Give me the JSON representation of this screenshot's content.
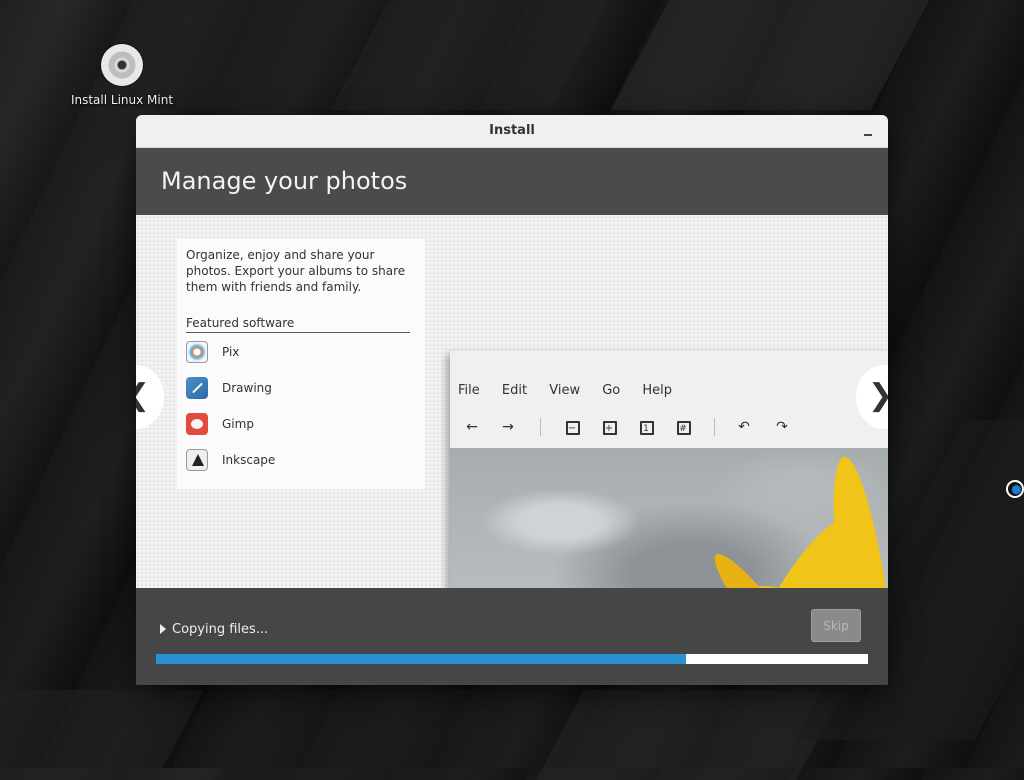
{
  "desktop": {
    "icon_label": "Install Linux Mint"
  },
  "window": {
    "title": "Install"
  },
  "header": {
    "heading": "Manage your photos"
  },
  "slide": {
    "description": "Organize, enjoy and share your photos. Export your albums to share them with friends and family.",
    "featured_label": "Featured software",
    "software": [
      {
        "name": "Pix",
        "icon": "pix-icon"
      },
      {
        "name": "Drawing",
        "icon": "drawing-icon"
      },
      {
        "name": "Gimp",
        "icon": "gimp-icon"
      },
      {
        "name": "Inkscape",
        "icon": "inkscape-icon"
      }
    ],
    "screenshot_menu": [
      "File",
      "Edit",
      "View",
      "Go",
      "Help"
    ],
    "toolbar_icons": [
      "arrow-left-icon",
      "arrow-right-icon",
      "zoom-out-icon",
      "zoom-in-icon",
      "zoom-original-icon",
      "zoom-fit-icon",
      "rotate-left-icon",
      "rotate-right-icon"
    ]
  },
  "footer": {
    "status": "Copying files...",
    "skip_label": "Skip",
    "skip_enabled": false,
    "progress": 0.745
  },
  "colors": {
    "progress_fill": "#2a90d4",
    "header_bg": "#4b4b4b"
  }
}
